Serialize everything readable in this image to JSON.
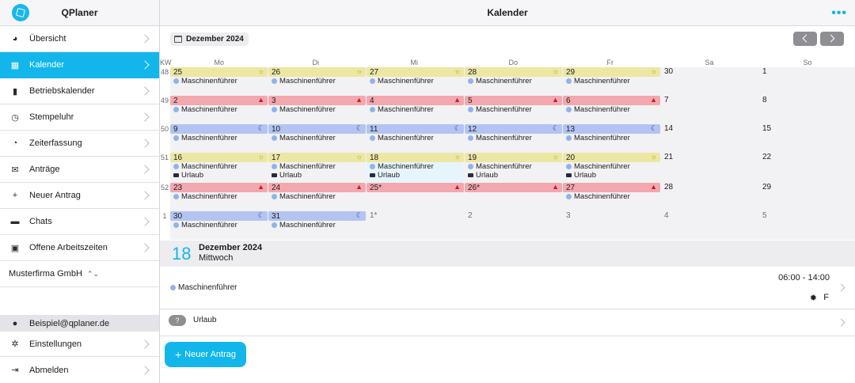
{
  "app": {
    "title": "QPlaner"
  },
  "sidebar": {
    "items": [
      {
        "label": "Übersicht",
        "icon": "dashboard-icon",
        "glyph": "◕",
        "active": false
      },
      {
        "label": "Kalender",
        "icon": "calendar-icon",
        "glyph": "▦",
        "active": true
      },
      {
        "label": "Betriebskalender",
        "icon": "building-icon",
        "glyph": "▮",
        "active": false
      },
      {
        "label": "Stempeluhr",
        "icon": "stopwatch-icon",
        "glyph": "◷",
        "active": false
      },
      {
        "label": "Zeiterfassung",
        "icon": "clock-icon",
        "glyph": "◔",
        "active": false
      },
      {
        "label": "Anträge",
        "icon": "envelope-icon",
        "glyph": "✉",
        "active": false
      },
      {
        "label": "Neuer Antrag",
        "icon": "plus-icon",
        "glyph": "+",
        "active": false
      },
      {
        "label": "Chats",
        "icon": "chat-icon",
        "glyph": "▬",
        "active": false
      },
      {
        "label": "Offene Arbeitszeiten",
        "icon": "calendar-check-icon",
        "glyph": "▣",
        "active": false
      }
    ],
    "company": "Musterfirma GmbH",
    "user_email": "Beispiel@qplaner.de",
    "settings_label": "Einstellungen",
    "logout_label": "Abmelden"
  },
  "header": {
    "title": "Kalender",
    "more": "•••"
  },
  "calendar": {
    "month_label": "Dezember 2024",
    "kw_label": "KW",
    "weekdays": [
      "Mo",
      "Di",
      "Mi",
      "Do",
      "Fr",
      "Sa",
      "So"
    ],
    "weeks": [
      {
        "kw": "48",
        "days": [
          {
            "num": "25",
            "kind": "sun",
            "entries": [
              "Maschinenführer"
            ]
          },
          {
            "num": "26",
            "kind": "sun",
            "entries": [
              "Maschinenführer"
            ]
          },
          {
            "num": "27",
            "kind": "sun",
            "entries": [
              "Maschinenführer"
            ]
          },
          {
            "num": "28",
            "kind": "sun",
            "entries": [
              "Maschinenführer"
            ]
          },
          {
            "num": "29",
            "kind": "sun",
            "entries": [
              "Maschinenführer"
            ]
          },
          {
            "num": "30",
            "kind": "plain",
            "entries": []
          },
          {
            "num": "1",
            "kind": "plain",
            "entries": []
          }
        ]
      },
      {
        "kw": "49",
        "days": [
          {
            "num": "2",
            "kind": "red",
            "entries": [
              "Maschinenführer"
            ]
          },
          {
            "num": "3",
            "kind": "red",
            "entries": [
              "Maschinenführer"
            ]
          },
          {
            "num": "4",
            "kind": "red",
            "entries": [
              "Maschinenführer"
            ]
          },
          {
            "num": "5",
            "kind": "red",
            "entries": [
              "Maschinenführer"
            ]
          },
          {
            "num": "6",
            "kind": "red",
            "entries": [
              "Maschinenführer"
            ]
          },
          {
            "num": "7",
            "kind": "plain",
            "entries": []
          },
          {
            "num": "8",
            "kind": "plain",
            "entries": []
          }
        ]
      },
      {
        "kw": "50",
        "days": [
          {
            "num": "9",
            "kind": "blue",
            "entries": [
              "Maschinenführer"
            ]
          },
          {
            "num": "10",
            "kind": "blue",
            "entries": [
              "Maschinenführer"
            ]
          },
          {
            "num": "11",
            "kind": "blue",
            "entries": [
              "Maschinenführer"
            ]
          },
          {
            "num": "12",
            "kind": "blue",
            "entries": [
              "Maschinenführer"
            ]
          },
          {
            "num": "13",
            "kind": "blue",
            "entries": [
              "Maschinenführer"
            ]
          },
          {
            "num": "14",
            "kind": "plain",
            "entries": []
          },
          {
            "num": "15",
            "kind": "plain",
            "entries": []
          }
        ]
      },
      {
        "kw": "51",
        "days": [
          {
            "num": "16",
            "kind": "sun",
            "entries": [
              "Maschinenführer"
            ],
            "leave": "Urlaub"
          },
          {
            "num": "17",
            "kind": "sun",
            "entries": [
              "Maschinenführer"
            ],
            "leave": "Urlaub"
          },
          {
            "num": "18",
            "kind": "sun",
            "entries": [
              "Maschinenführer"
            ],
            "leave": "Urlaub",
            "selected": true
          },
          {
            "num": "19",
            "kind": "sun",
            "entries": [
              "Maschinenführer"
            ],
            "leave": "Urlaub"
          },
          {
            "num": "20",
            "kind": "sun",
            "entries": [
              "Maschinenführer"
            ],
            "leave": "Urlaub"
          },
          {
            "num": "21",
            "kind": "plain",
            "entries": []
          },
          {
            "num": "22",
            "kind": "plain",
            "entries": []
          }
        ]
      },
      {
        "kw": "52",
        "days": [
          {
            "num": "23",
            "kind": "red",
            "entries": [
              "Maschinenführer"
            ]
          },
          {
            "num": "24",
            "kind": "red",
            "entries": [
              "Maschinenführer"
            ]
          },
          {
            "num": "25*",
            "kind": "red",
            "entries": []
          },
          {
            "num": "26*",
            "kind": "red",
            "entries": []
          },
          {
            "num": "27",
            "kind": "red",
            "entries": [
              "Maschinenführer"
            ]
          },
          {
            "num": "28",
            "kind": "plain",
            "entries": []
          },
          {
            "num": "29",
            "kind": "plain",
            "entries": []
          }
        ]
      },
      {
        "kw": "1",
        "days": [
          {
            "num": "30",
            "kind": "blue",
            "entries": [
              "Maschinenführer"
            ]
          },
          {
            "num": "31",
            "kind": "blue",
            "entries": [
              "Maschinenführer"
            ]
          },
          {
            "num": "1*",
            "kind": "gray",
            "entries": []
          },
          {
            "num": "2",
            "kind": "gray",
            "entries": []
          },
          {
            "num": "3",
            "kind": "gray",
            "entries": []
          },
          {
            "num": "4",
            "kind": "gray",
            "entries": []
          },
          {
            "num": "5",
            "kind": "gray",
            "entries": []
          }
        ]
      }
    ],
    "shift_icons": {
      "sun": "☼",
      "red": "▲",
      "blue": "☾"
    },
    "colors": {
      "sun": "#ece7a3",
      "red": "#f3a7ae",
      "blue": "#b3c4f1",
      "accent": "#12b6ea"
    }
  },
  "detail": {
    "day": "18",
    "month": "Dezember 2024",
    "weekday": "Mittwoch",
    "shift": {
      "name": "Maschinenführer",
      "time": "06:00 - 14:00",
      "code": "F",
      "code_icon": "gear-icon"
    },
    "leave": {
      "badge": "?",
      "label": "Urlaub"
    }
  },
  "new_request_button": "Neuer Antrag"
}
